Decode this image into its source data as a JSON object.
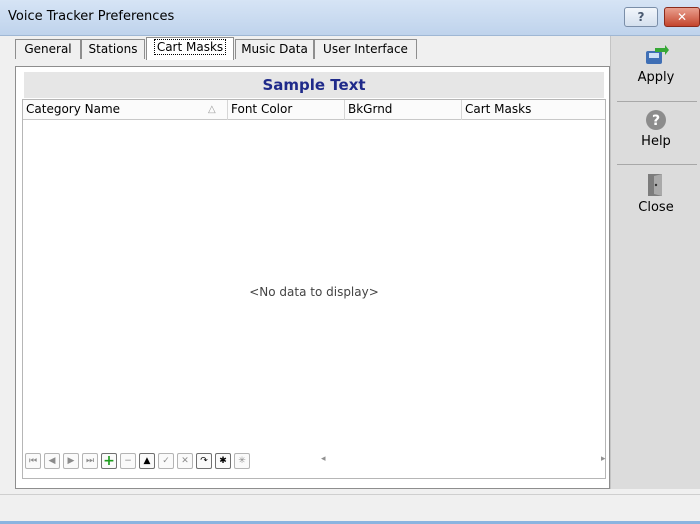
{
  "window": {
    "title": "Voice Tracker Preferences",
    "help_glyph": "?",
    "close_glyph": "✕"
  },
  "tabs": [
    {
      "label": "General"
    },
    {
      "label": "Stations"
    },
    {
      "label": "Cart Masks"
    },
    {
      "label": "Music Data"
    },
    {
      "label": "User Interface"
    }
  ],
  "sample_text": "Sample Text",
  "grid": {
    "columns": [
      "Category Name",
      "Font Color",
      "BkGrnd",
      "Cart Masks"
    ],
    "sort_glyph": "△",
    "empty_text": "<No data to display>"
  },
  "navigator": {
    "buttons": [
      {
        "icon": "first-page-icon",
        "glyph": "⏮"
      },
      {
        "icon": "prev-page-icon",
        "glyph": "◀"
      },
      {
        "icon": "next-page-icon",
        "glyph": "▶"
      },
      {
        "icon": "last-page-icon",
        "glyph": "⏭"
      },
      {
        "icon": "add-icon",
        "glyph": "+"
      },
      {
        "icon": "remove-icon",
        "glyph": "−"
      },
      {
        "icon": "move-up-icon",
        "glyph": "▲"
      },
      {
        "icon": "confirm-icon",
        "glyph": "✓"
      },
      {
        "icon": "cancel-icon",
        "glyph": "✕"
      },
      {
        "icon": "refresh-icon",
        "glyph": "↷"
      },
      {
        "icon": "asterisk-icon",
        "glyph": "✱"
      },
      {
        "icon": "new-row-icon",
        "glyph": "✳"
      }
    ],
    "scroll_left_glyph": "◂",
    "scroll_right_glyph": "▸"
  },
  "actions": {
    "apply": {
      "label": "Apply",
      "icon": "apply-icon"
    },
    "help": {
      "label": "Help",
      "icon": "help-icon"
    },
    "close": {
      "label": "Close",
      "icon": "door-icon"
    }
  },
  "colors": {
    "sample_text": "#1f2a8a",
    "accent_green": "#1d9b1d",
    "close_red": "#c4452d"
  }
}
